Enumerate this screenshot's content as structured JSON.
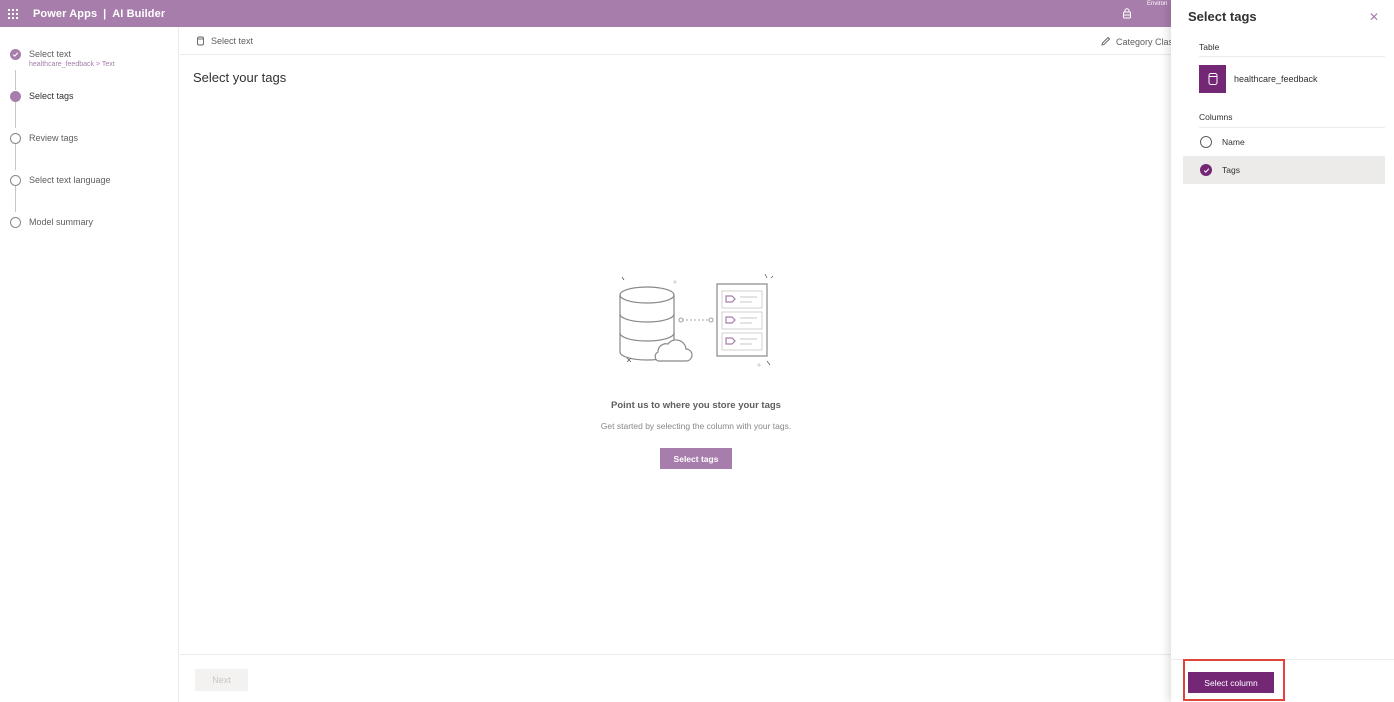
{
  "topbar": {
    "app_name": "Power Apps",
    "separator": "|",
    "product": "AI Builder",
    "environment_label": "Environ",
    "waffle_icon": "waffle-icon",
    "environment_icon": "environment-icon"
  },
  "stepper": {
    "steps": [
      {
        "label": "Select text",
        "sub": "healthcare_feedback > Text",
        "state": "done"
      },
      {
        "label": "Select tags",
        "sub": "",
        "state": "current"
      },
      {
        "label": "Review tags",
        "sub": "",
        "state": "pending"
      },
      {
        "label": "Select text language",
        "sub": "",
        "state": "pending"
      },
      {
        "label": "Model summary",
        "sub": "",
        "state": "pending"
      }
    ]
  },
  "main": {
    "breadcrumb": "Select text",
    "model_name": "Category Clas",
    "page_title": "Select your tags",
    "empty_title": "Point us to where you store your tags",
    "empty_subtitle": "Get started by selecting the column with your tags.",
    "select_tags_button": "Select tags",
    "next_button": "Next"
  },
  "panel": {
    "title": "Select tags",
    "close_icon": "close-icon",
    "table_label": "Table",
    "table_name": "healthcare_feedback",
    "columns_label": "Columns",
    "columns": [
      {
        "name": "Name",
        "selected": false
      },
      {
        "name": "Tags",
        "selected": true
      }
    ],
    "select_column_button": "Select column"
  },
  "colors": {
    "brand": "#a77dab",
    "brand_dark": "#742774",
    "highlight": "#e0453c"
  }
}
